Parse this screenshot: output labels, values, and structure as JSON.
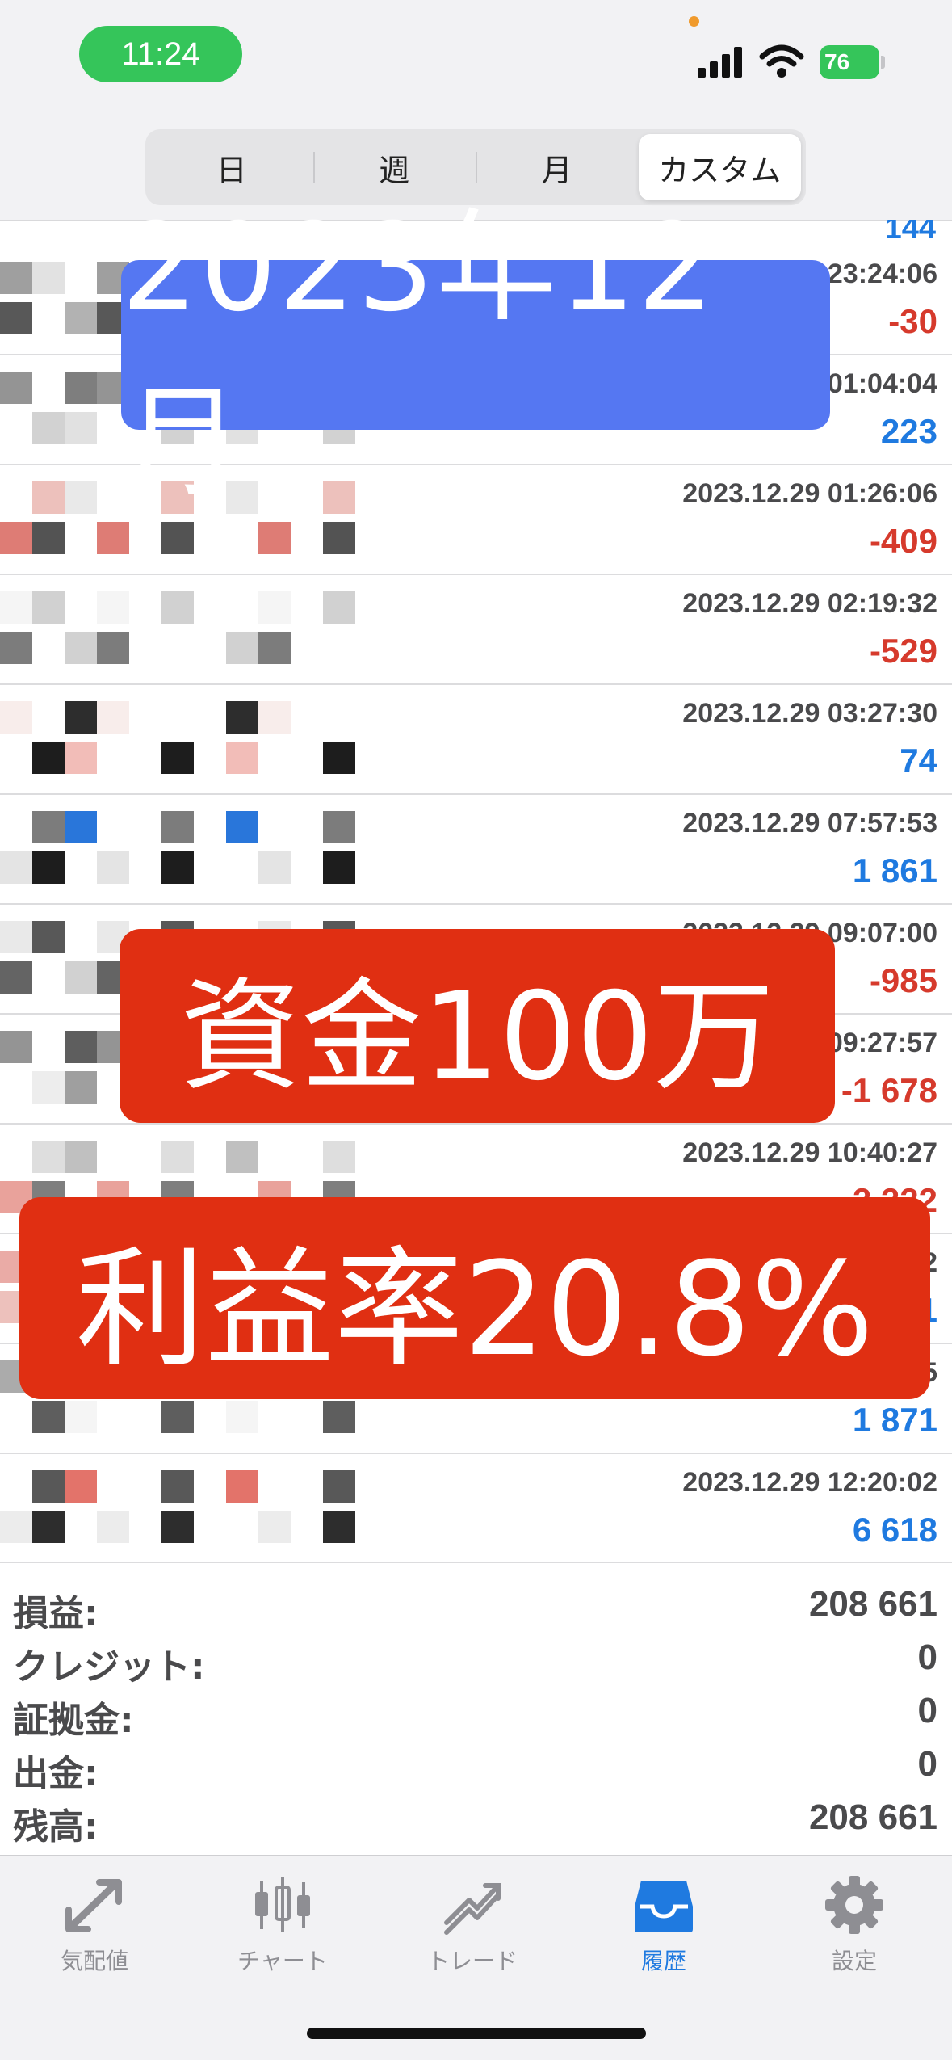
{
  "status": {
    "time": "11:24",
    "battery": "76"
  },
  "segments": [
    {
      "label": "日",
      "active": false
    },
    {
      "label": "週",
      "active": false
    },
    {
      "label": "月",
      "active": false
    },
    {
      "label": "カスタム",
      "active": true
    }
  ],
  "partial_top_value": "144",
  "rows": [
    {
      "date": "2023.12.28 23:24:06",
      "profit": "-30",
      "sign": "neg"
    },
    {
      "date": "2023.12.29 01:04:04",
      "profit": "223",
      "sign": "pos"
    },
    {
      "date": "2023.12.29 01:26:06",
      "profit": "-409",
      "sign": "neg"
    },
    {
      "date": "2023.12.29 02:19:32",
      "profit": "-529",
      "sign": "neg"
    },
    {
      "date": "2023.12.29 03:27:30",
      "profit": "74",
      "sign": "pos"
    },
    {
      "date": "2023.12.29 07:57:53",
      "profit": "1 861",
      "sign": "pos"
    },
    {
      "date": "2023.12.29 09:07:00",
      "profit": "-985",
      "sign": "neg"
    },
    {
      "date": "2023.12.29 09:27:57",
      "profit": "-1 678",
      "sign": "neg"
    },
    {
      "date": "2023.12.29 10:40:27",
      "profit": "-2 222",
      "sign": "neg"
    },
    {
      "date": "2023.12.29 10:58:52",
      "profit": "151",
      "sign": "pos"
    },
    {
      "date": "2023.12.29 11:34:15",
      "profit": "1 871",
      "sign": "pos"
    },
    {
      "date": "2023.12.29 12:20:02",
      "profit": "6 618",
      "sign": "pos"
    }
  ],
  "overlays": {
    "month": "2023年12月",
    "capital": "資金100万",
    "profit_rate": "利益率20.8%"
  },
  "summary": [
    {
      "label": "損益:",
      "value": "208 661"
    },
    {
      "label": "クレジット:",
      "value": "0"
    },
    {
      "label": "証拠金:",
      "value": "0"
    },
    {
      "label": "出金:",
      "value": "0"
    },
    {
      "label": "残高:",
      "value": "208 661"
    }
  ],
  "tabs": [
    {
      "label": "気配値",
      "icon": "quotes-icon",
      "active": false
    },
    {
      "label": "チャート",
      "icon": "candlestick-icon",
      "active": false
    },
    {
      "label": "トレード",
      "icon": "trade-icon",
      "active": false
    },
    {
      "label": "履歴",
      "icon": "history-inbox-icon",
      "active": true
    },
    {
      "label": "設定",
      "icon": "gear-icon",
      "active": false
    }
  ],
  "colors": {
    "positive": "#1f7ae0",
    "negative": "#d63a2c",
    "accent": "#1f7ae0"
  }
}
